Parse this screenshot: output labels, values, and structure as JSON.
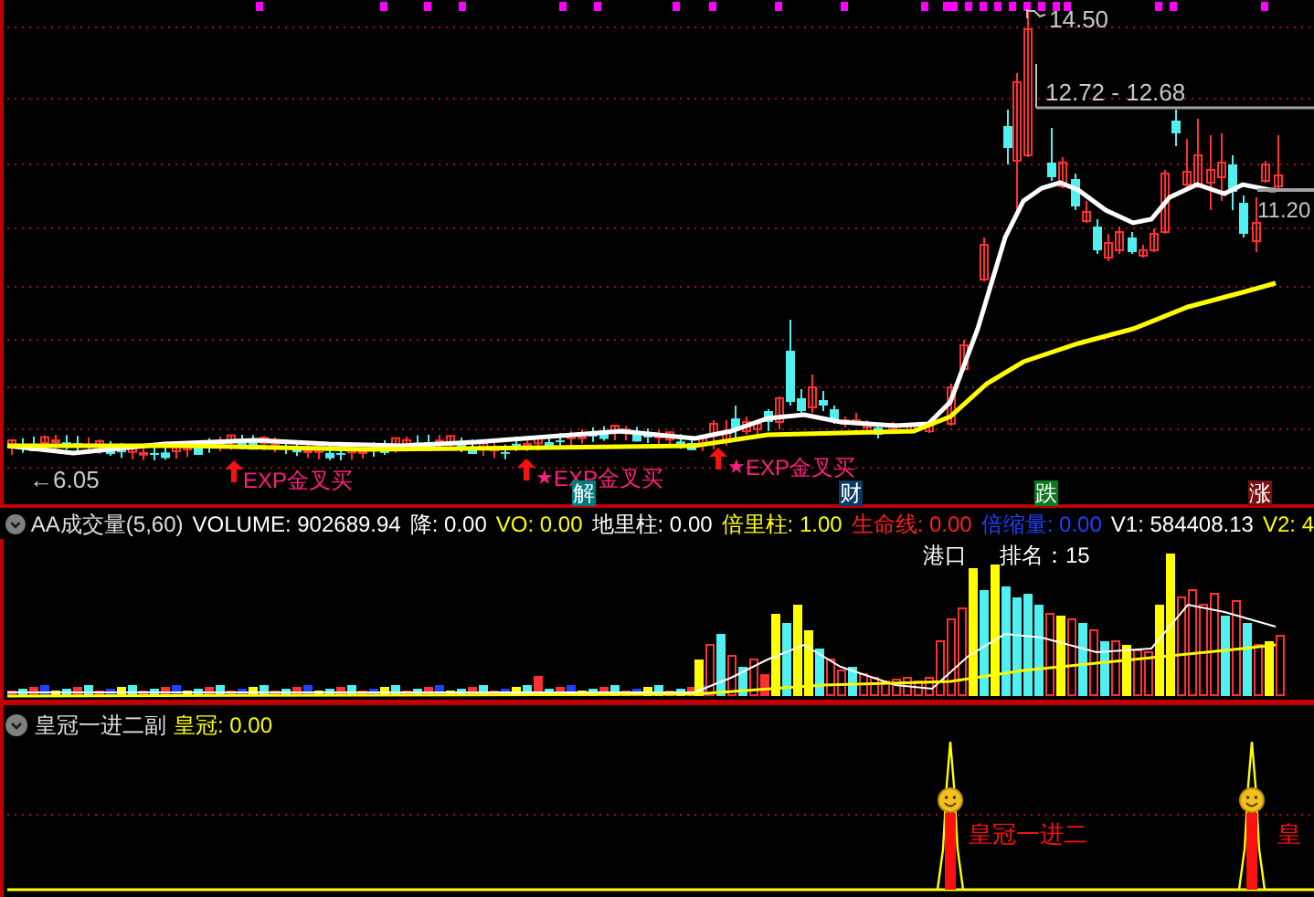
{
  "main_chart": {
    "high_label": "14.50",
    "range_label": "12.72 - 12.68",
    "last_label": "11.20",
    "low_label": "←6.05",
    "signals": [
      {
        "text": "EXP金叉买"
      },
      {
        "text": "EXP金叉买",
        "marker": "★"
      },
      {
        "text": "EXP金叉买",
        "marker": "★"
      }
    ],
    "event_markers": [
      {
        "text": "解",
        "color": "#007b80"
      },
      {
        "text": "财",
        "color": "#0a3a66"
      },
      {
        "text": "跌",
        "color": "#0a7a1e"
      },
      {
        "text": "涨",
        "color": "#7a1010"
      }
    ]
  },
  "volume_panel": {
    "title": "AA成交量(5,60)",
    "readings": [
      {
        "text": "VOLUME: 902689.94",
        "color": "#ffffff"
      },
      {
        "text": "降: 0.00",
        "color": "#ffffff"
      },
      {
        "text": "VO: 0.00",
        "color": "#ffff00"
      },
      {
        "text": "地里柱: 0.00",
        "color": "#ffffff"
      },
      {
        "text": "倍里柱: 1.00",
        "color": "#ffff00"
      },
      {
        "text": "生命线: 0.00",
        "color": "#ff2020"
      },
      {
        "text": "倍缩量: 0.00",
        "color": "#2040ff"
      },
      {
        "text": "V1: 584408.13",
        "color": "#ffffff"
      },
      {
        "text": "V2: 4",
        "color": "#ffff00"
      }
    ],
    "annotations": [
      "港口",
      "排名：15"
    ]
  },
  "crown_panel": {
    "title": "皇冠一进二副",
    "reading": "皇冠: 0.00",
    "labels": [
      "皇冠一进二",
      "皇"
    ]
  }
}
